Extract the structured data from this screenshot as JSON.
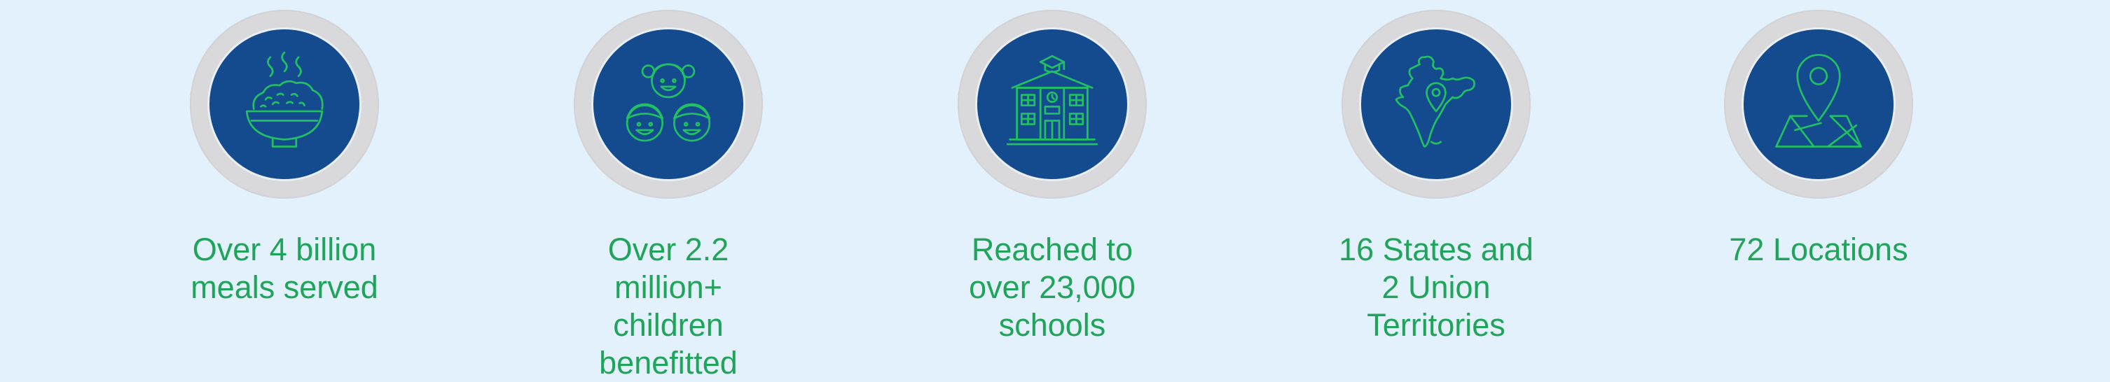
{
  "colors": {
    "background": "#e3f1fc",
    "ring": "#d9d9db",
    "disc": "#134b8e",
    "icon_stroke": "#22c063",
    "label": "#1fa45a"
  },
  "stats": [
    {
      "icon": "food-bowl-icon",
      "label": "Over 4 billion\nmeals served"
    },
    {
      "icon": "children-faces-icon",
      "label": "Over 2.2\nmillion+\nchildren\nbenefitted"
    },
    {
      "icon": "school-building-icon",
      "label": "Reached to\nover 23,000\nschools"
    },
    {
      "icon": "india-map-pin-icon",
      "label": "16 States and\n2 Union\nTerritories"
    },
    {
      "icon": "location-map-icon",
      "label": "72 Locations"
    }
  ]
}
